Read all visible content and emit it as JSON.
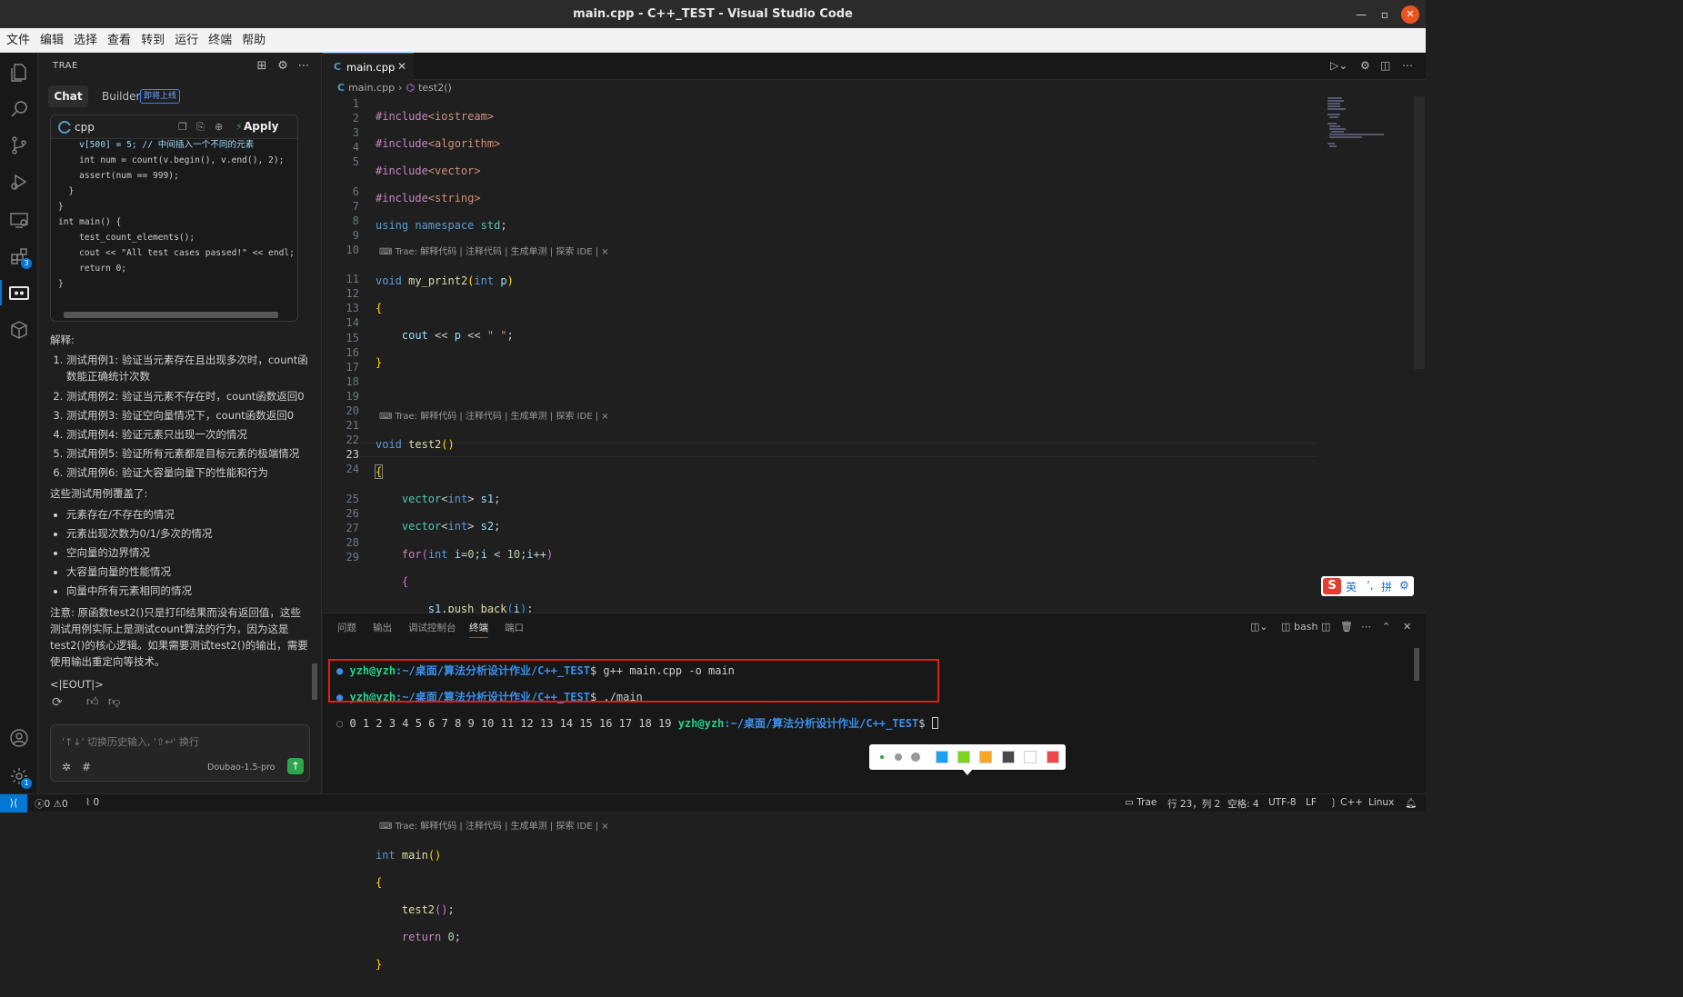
{
  "window": {
    "title": "main.cpp - C++_TEST - Visual Studio Code"
  },
  "menu": [
    "文件",
    "编辑",
    "选择",
    "查看",
    "转到",
    "运行",
    "终端",
    "帮助"
  ],
  "activity_badges": {
    "extensions": "3",
    "settings": "1"
  },
  "panel": {
    "title": "TRAE",
    "tabs": {
      "chat": "Chat",
      "builder": "Builder",
      "builder_badge": "即将上线"
    },
    "code_block": {
      "lang": "cpp",
      "apply": "Apply",
      "lines": [
        "    v[500] = 5; // 中间插入一个不同的元素",
        "    int num = count(v.begin(), v.end(), 2);",
        "    assert(num == 999);",
        "  }",
        "}",
        "",
        "int main() {",
        "    test_count_elements();",
        "    cout << \"All test cases passed!\" << endl;",
        "    return 0;",
        "}"
      ]
    },
    "explain_title": "解释:",
    "explain_items": [
      "测试用例1: 验证当元素存在且出现多次时，count函数能正确统计次数",
      "测试用例2: 验证当元素不存在时，count函数返回0",
      "测试用例3: 验证空向量情况下，count函数返回0",
      "测试用例4: 验证元素只出现一次的情况",
      "测试用例5: 验证所有元素都是目标元素的极端情况",
      "测试用例6: 验证大容量向量下的性能和行为"
    ],
    "cover_title": "这些测试用例覆盖了:",
    "cover_items": [
      "元素存在/不存在的情况",
      "元素出现次数为0/1/多次的情况",
      "空向量的边界情况",
      "大容量向量的性能情况",
      "向量中所有元素相同的情况"
    ],
    "note": "注意: 原函数test2()只是打印结果而没有返回值，这些测试用例实际上是测试count算法的行为，因为这是test2()的核心逻辑。如果需要测试test2()的输出，需要使用输出重定向等技术。",
    "eout": "<|EOUT|>",
    "input_placeholder": "'↑↓' 切换历史输入, '⇧↩' 换行",
    "model": "Doubao-1.5-pro"
  },
  "editor": {
    "tab": "main.cpp",
    "breadcrumb": [
      "main.cpp",
      "test2()"
    ],
    "codelens": "Trae: 解释代码 | 注释代码 | 生成单测 | 探索 IDE | ×",
    "line_numbers": [
      "1",
      "2",
      "3",
      "4",
      "5",
      "6",
      "7",
      "8",
      "9",
      "10",
      "11",
      "12",
      "13",
      "14",
      "15",
      "16",
      "17",
      "18",
      "19",
      "20",
      "21",
      "22",
      "23",
      "24",
      "25",
      "26",
      "27",
      "28",
      "29"
    ]
  },
  "terminal": {
    "tabs": [
      "问题",
      "输出",
      "调试控制台",
      "终端",
      "端口"
    ],
    "active_tab": "终端",
    "shell": "bash",
    "prompt_user": "yzh@yzh",
    "prompt_path": ":~/桌面/算法分析设计作业/C++_TEST",
    "cmd1": "$ g++ main.cpp -o main",
    "cmd2": "$ ./main",
    "output": "0 1 2 3 4 5 6 7 8 9 10 11 12 13 14 15 16 17 18 19 ",
    "prompt_end": "$ "
  },
  "ime": {
    "lang": "英",
    "mode": "拼"
  },
  "palette_colors": [
    "#1ea0f2",
    "#7ed321",
    "#f5a623",
    "#4a4a4a",
    "#ffffff",
    "#f04848"
  ],
  "status": {
    "errors": "0",
    "warnings": "0",
    "ports": "0",
    "trae": "Trae",
    "position": "行 23，列 2",
    "spaces": "空格: 4",
    "encoding": "UTF-8",
    "eol": "LF",
    "language": "C++",
    "platform": "Linux"
  }
}
